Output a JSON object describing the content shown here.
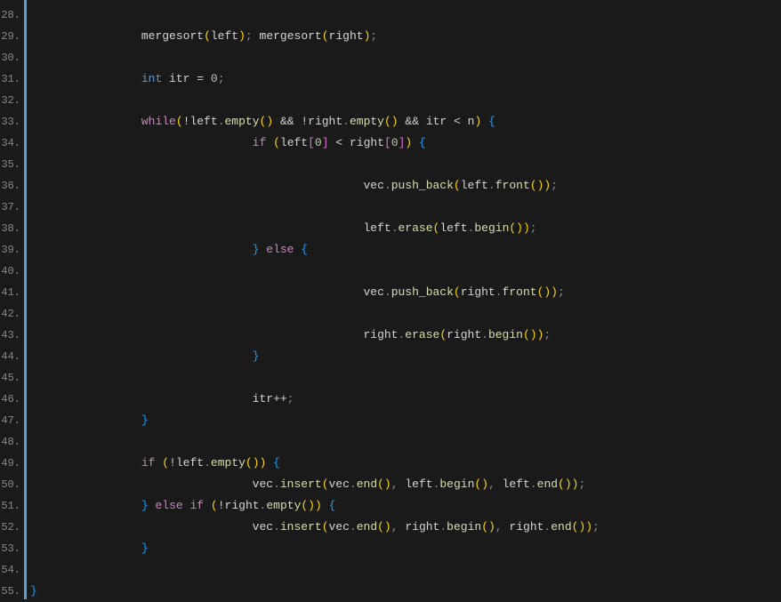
{
  "gutter": {
    "start": 28,
    "end": 55
  },
  "code": {
    "lines": [
      {
        "indent": 0,
        "tokens": []
      },
      {
        "indent": 2,
        "tokens": [
          {
            "text": "mergesort",
            "cls": "plain"
          },
          {
            "text": "(",
            "cls": "paren"
          },
          {
            "text": "left",
            "cls": "plain"
          },
          {
            "text": ")",
            "cls": "paren"
          },
          {
            "text": ";",
            "cls": "punct"
          },
          {
            "text": " mergesort",
            "cls": "plain"
          },
          {
            "text": "(",
            "cls": "paren"
          },
          {
            "text": "right",
            "cls": "plain"
          },
          {
            "text": ")",
            "cls": "paren"
          },
          {
            "text": ";",
            "cls": "punct"
          }
        ]
      },
      {
        "indent": 0,
        "tokens": []
      },
      {
        "indent": 2,
        "tokens": [
          {
            "text": "int",
            "cls": "type"
          },
          {
            "text": " itr ",
            "cls": "plain"
          },
          {
            "text": "=",
            "cls": "operator"
          },
          {
            "text": " ",
            "cls": "plain"
          },
          {
            "text": "0",
            "cls": "number"
          },
          {
            "text": ";",
            "cls": "punct"
          }
        ]
      },
      {
        "indent": 0,
        "tokens": []
      },
      {
        "indent": 2,
        "tokens": [
          {
            "text": "while",
            "cls": "keyword"
          },
          {
            "text": "(",
            "cls": "paren"
          },
          {
            "text": "!left",
            "cls": "plain"
          },
          {
            "text": ".",
            "cls": "punct"
          },
          {
            "text": "empty",
            "cls": "method"
          },
          {
            "text": "()",
            "cls": "paren"
          },
          {
            "text": " ",
            "cls": "plain"
          },
          {
            "text": "&&",
            "cls": "operator"
          },
          {
            "text": " !right",
            "cls": "plain"
          },
          {
            "text": ".",
            "cls": "punct"
          },
          {
            "text": "empty",
            "cls": "method"
          },
          {
            "text": "()",
            "cls": "paren"
          },
          {
            "text": " ",
            "cls": "plain"
          },
          {
            "text": "&&",
            "cls": "operator"
          },
          {
            "text": " itr ",
            "cls": "plain"
          },
          {
            "text": "<",
            "cls": "operator"
          },
          {
            "text": " n",
            "cls": "plain"
          },
          {
            "text": ")",
            "cls": "paren"
          },
          {
            "text": " ",
            "cls": "plain"
          },
          {
            "text": "{",
            "cls": "brace"
          }
        ]
      },
      {
        "indent": 4,
        "tokens": [
          {
            "text": "if",
            "cls": "keyword"
          },
          {
            "text": " ",
            "cls": "plain"
          },
          {
            "text": "(",
            "cls": "paren"
          },
          {
            "text": "left",
            "cls": "plain"
          },
          {
            "text": "[",
            "cls": "bracket"
          },
          {
            "text": "0",
            "cls": "number"
          },
          {
            "text": "]",
            "cls": "bracket"
          },
          {
            "text": " ",
            "cls": "plain"
          },
          {
            "text": "<",
            "cls": "operator"
          },
          {
            "text": " right",
            "cls": "plain"
          },
          {
            "text": "[",
            "cls": "bracket"
          },
          {
            "text": "0",
            "cls": "number"
          },
          {
            "text": "]",
            "cls": "bracket"
          },
          {
            "text": ")",
            "cls": "paren"
          },
          {
            "text": " ",
            "cls": "plain"
          },
          {
            "text": "{",
            "cls": "brace"
          }
        ]
      },
      {
        "indent": 0,
        "tokens": []
      },
      {
        "indent": 6,
        "tokens": [
          {
            "text": "vec",
            "cls": "plain"
          },
          {
            "text": ".",
            "cls": "punct"
          },
          {
            "text": "push_back",
            "cls": "method"
          },
          {
            "text": "(",
            "cls": "paren"
          },
          {
            "text": "left",
            "cls": "plain"
          },
          {
            "text": ".",
            "cls": "punct"
          },
          {
            "text": "front",
            "cls": "method"
          },
          {
            "text": "())",
            "cls": "paren"
          },
          {
            "text": ";",
            "cls": "punct"
          }
        ]
      },
      {
        "indent": 0,
        "tokens": []
      },
      {
        "indent": 6,
        "tokens": [
          {
            "text": "left",
            "cls": "plain"
          },
          {
            "text": ".",
            "cls": "punct"
          },
          {
            "text": "erase",
            "cls": "method"
          },
          {
            "text": "(",
            "cls": "paren"
          },
          {
            "text": "left",
            "cls": "plain"
          },
          {
            "text": ".",
            "cls": "punct"
          },
          {
            "text": "begin",
            "cls": "method"
          },
          {
            "text": "())",
            "cls": "paren"
          },
          {
            "text": ";",
            "cls": "punct"
          }
        ]
      },
      {
        "indent": 4,
        "tokens": [
          {
            "text": "}",
            "cls": "brace"
          },
          {
            "text": " ",
            "cls": "plain"
          },
          {
            "text": "else",
            "cls": "keyword"
          },
          {
            "text": " ",
            "cls": "plain"
          },
          {
            "text": "{",
            "cls": "brace"
          }
        ]
      },
      {
        "indent": 0,
        "tokens": []
      },
      {
        "indent": 6,
        "tokens": [
          {
            "text": "vec",
            "cls": "plain"
          },
          {
            "text": ".",
            "cls": "punct"
          },
          {
            "text": "push_back",
            "cls": "method"
          },
          {
            "text": "(",
            "cls": "paren"
          },
          {
            "text": "right",
            "cls": "plain"
          },
          {
            "text": ".",
            "cls": "punct"
          },
          {
            "text": "front",
            "cls": "method"
          },
          {
            "text": "())",
            "cls": "paren"
          },
          {
            "text": ";",
            "cls": "punct"
          }
        ]
      },
      {
        "indent": 0,
        "tokens": []
      },
      {
        "indent": 6,
        "tokens": [
          {
            "text": "right",
            "cls": "plain"
          },
          {
            "text": ".",
            "cls": "punct"
          },
          {
            "text": "erase",
            "cls": "method"
          },
          {
            "text": "(",
            "cls": "paren"
          },
          {
            "text": "right",
            "cls": "plain"
          },
          {
            "text": ".",
            "cls": "punct"
          },
          {
            "text": "begin",
            "cls": "method"
          },
          {
            "text": "())",
            "cls": "paren"
          },
          {
            "text": ";",
            "cls": "punct"
          }
        ]
      },
      {
        "indent": 4,
        "tokens": [
          {
            "text": "}",
            "cls": "brace"
          }
        ]
      },
      {
        "indent": 0,
        "tokens": []
      },
      {
        "indent": 4,
        "tokens": [
          {
            "text": "itr",
            "cls": "plain"
          },
          {
            "text": "++",
            "cls": "operator"
          },
          {
            "text": ";",
            "cls": "punct"
          }
        ]
      },
      {
        "indent": 2,
        "tokens": [
          {
            "text": "}",
            "cls": "brace"
          }
        ]
      },
      {
        "indent": 0,
        "tokens": []
      },
      {
        "indent": 2,
        "tokens": [
          {
            "text": "if",
            "cls": "keyword"
          },
          {
            "text": " ",
            "cls": "plain"
          },
          {
            "text": "(",
            "cls": "paren"
          },
          {
            "text": "!left",
            "cls": "plain"
          },
          {
            "text": ".",
            "cls": "punct"
          },
          {
            "text": "empty",
            "cls": "method"
          },
          {
            "text": "())",
            "cls": "paren"
          },
          {
            "text": " ",
            "cls": "plain"
          },
          {
            "text": "{",
            "cls": "brace"
          }
        ]
      },
      {
        "indent": 4,
        "tokens": [
          {
            "text": "vec",
            "cls": "plain"
          },
          {
            "text": ".",
            "cls": "punct"
          },
          {
            "text": "insert",
            "cls": "method"
          },
          {
            "text": "(",
            "cls": "paren"
          },
          {
            "text": "vec",
            "cls": "plain"
          },
          {
            "text": ".",
            "cls": "punct"
          },
          {
            "text": "end",
            "cls": "method"
          },
          {
            "text": "()",
            "cls": "paren"
          },
          {
            "text": ",",
            "cls": "punct"
          },
          {
            "text": " left",
            "cls": "plain"
          },
          {
            "text": ".",
            "cls": "punct"
          },
          {
            "text": "begin",
            "cls": "method"
          },
          {
            "text": "()",
            "cls": "paren"
          },
          {
            "text": ",",
            "cls": "punct"
          },
          {
            "text": " left",
            "cls": "plain"
          },
          {
            "text": ".",
            "cls": "punct"
          },
          {
            "text": "end",
            "cls": "method"
          },
          {
            "text": "())",
            "cls": "paren"
          },
          {
            "text": ";",
            "cls": "punct"
          }
        ]
      },
      {
        "indent": 2,
        "tokens": [
          {
            "text": "}",
            "cls": "brace"
          },
          {
            "text": " ",
            "cls": "plain"
          },
          {
            "text": "else",
            "cls": "keyword"
          },
          {
            "text": " ",
            "cls": "plain"
          },
          {
            "text": "if",
            "cls": "keyword"
          },
          {
            "text": " ",
            "cls": "plain"
          },
          {
            "text": "(",
            "cls": "paren"
          },
          {
            "text": "!right",
            "cls": "plain"
          },
          {
            "text": ".",
            "cls": "punct"
          },
          {
            "text": "empty",
            "cls": "method"
          },
          {
            "text": "())",
            "cls": "paren"
          },
          {
            "text": " ",
            "cls": "plain"
          },
          {
            "text": "{",
            "cls": "brace"
          }
        ]
      },
      {
        "indent": 4,
        "tokens": [
          {
            "text": "vec",
            "cls": "plain"
          },
          {
            "text": ".",
            "cls": "punct"
          },
          {
            "text": "insert",
            "cls": "method"
          },
          {
            "text": "(",
            "cls": "paren"
          },
          {
            "text": "vec",
            "cls": "plain"
          },
          {
            "text": ".",
            "cls": "punct"
          },
          {
            "text": "end",
            "cls": "method"
          },
          {
            "text": "()",
            "cls": "paren"
          },
          {
            "text": ",",
            "cls": "punct"
          },
          {
            "text": " right",
            "cls": "plain"
          },
          {
            "text": ".",
            "cls": "punct"
          },
          {
            "text": "begin",
            "cls": "method"
          },
          {
            "text": "()",
            "cls": "paren"
          },
          {
            "text": ",",
            "cls": "punct"
          },
          {
            "text": " right",
            "cls": "plain"
          },
          {
            "text": ".",
            "cls": "punct"
          },
          {
            "text": "end",
            "cls": "method"
          },
          {
            "text": "())",
            "cls": "paren"
          },
          {
            "text": ";",
            "cls": "punct"
          }
        ]
      },
      {
        "indent": 2,
        "tokens": [
          {
            "text": "}",
            "cls": "brace"
          }
        ]
      },
      {
        "indent": 0,
        "tokens": []
      },
      {
        "indent": 0,
        "tokens": [
          {
            "text": "}",
            "cls": "brace"
          }
        ]
      }
    ]
  }
}
